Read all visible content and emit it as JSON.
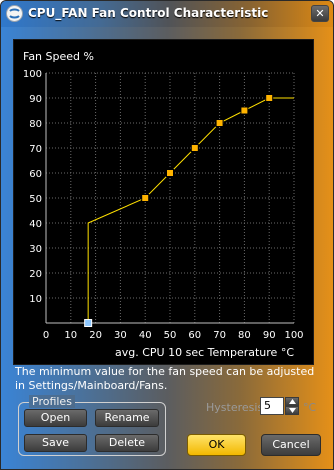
{
  "window": {
    "title": "CPU_FAN Fan Control Characteristic",
    "close_glyph": "✕"
  },
  "chart_data": {
    "type": "line",
    "ylabel": "Fan Speed %",
    "xlabel": "avg. CPU 10 sec Temperature °C",
    "xlim": [
      0,
      100
    ],
    "ylim": [
      0,
      100
    ],
    "x_ticks": [
      0,
      10,
      20,
      30,
      40,
      50,
      60,
      70,
      80,
      90,
      100
    ],
    "y_ticks": [
      10,
      20,
      30,
      40,
      50,
      60,
      70,
      80,
      90,
      100
    ],
    "grid": true,
    "line_color": "#ffe000",
    "point_color": "#ffb400",
    "min_point_color": "#8fc8ff",
    "points": [
      {
        "x": 17,
        "y": 0
      },
      {
        "x": 40,
        "y": 50
      },
      {
        "x": 50,
        "y": 60
      },
      {
        "x": 60,
        "y": 70
      },
      {
        "x": 70,
        "y": 80
      },
      {
        "x": 80,
        "y": 85
      },
      {
        "x": 90,
        "y": 90
      }
    ],
    "line": [
      [
        17,
        0
      ],
      [
        17,
        40
      ],
      [
        40,
        50
      ],
      [
        50,
        60
      ],
      [
        60,
        70
      ],
      [
        70,
        80
      ],
      [
        80,
        85
      ],
      [
        90,
        90
      ],
      [
        100,
        90
      ]
    ]
  },
  "info_text": "The minimum value for the fan speed can be adjusted in Settings/Mainboard/Fans.",
  "profiles": {
    "label": "Profiles",
    "open": "Open",
    "rename": "Rename",
    "save": "Save",
    "delete": "Delete"
  },
  "hysteresis": {
    "label": "Hysteresis",
    "value": "5",
    "unit": "°C"
  },
  "buttons": {
    "ok": "OK",
    "cancel": "Cancel"
  },
  "colors": {
    "accent_yellow": "#f2b800",
    "title_blue": "#2f78cc",
    "title_orange": "#e08a12"
  }
}
